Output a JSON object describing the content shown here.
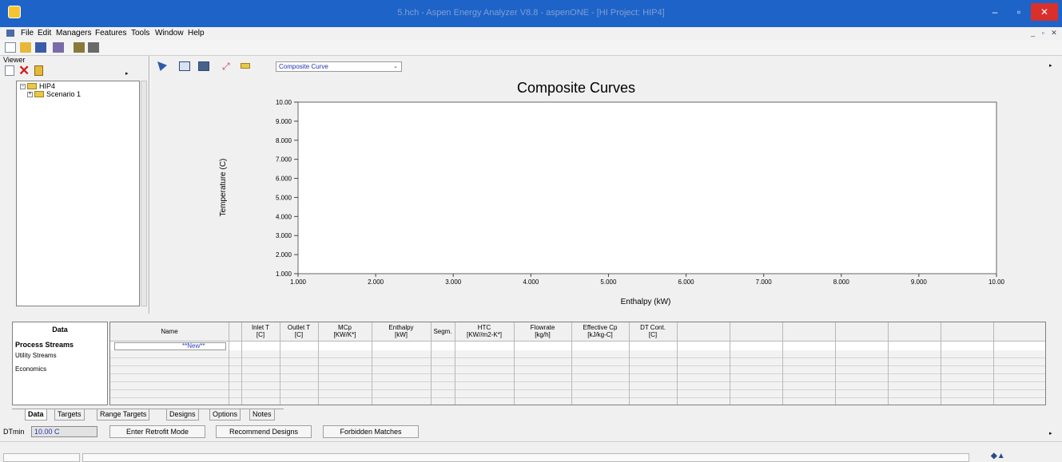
{
  "window": {
    "title": "5.hch - Aspen Energy Analyzer V8.8 - aspenONE - [HI Project: HIP4]",
    "controls": {
      "minimize": "–",
      "maximize": "▫",
      "close": "✕"
    }
  },
  "menu": [
    "File",
    "Edit",
    "Managers",
    "Features",
    "Tools",
    "Window",
    "Help"
  ],
  "viewer": {
    "label": "Viewer",
    "tree": {
      "root": "HIP4",
      "child": "Scenario 1"
    }
  },
  "chart_toolbar": {
    "selected_view": "Composite Curve"
  },
  "chart_data": {
    "type": "line",
    "title": "Composite Curves",
    "xlabel": "Enthalpy (kW)",
    "ylabel": "Temperature (C)",
    "xlim": [
      1.0,
      10.0
    ],
    "ylim": [
      1.0,
      10.0
    ],
    "x_ticks": [
      "1.000",
      "2.000",
      "3.000",
      "4.000",
      "5.000",
      "6.000",
      "7.000",
      "8.000",
      "9.000",
      "10.00"
    ],
    "y_ticks": [
      "1.000",
      "2.000",
      "3.000",
      "4.000",
      "5.000",
      "6.000",
      "7.000",
      "8.000",
      "9.000",
      "10.00"
    ],
    "series": []
  },
  "data_panel": {
    "header": "Data",
    "items": [
      "Process Streams",
      "Utility Streams",
      "Economics"
    ]
  },
  "grid": {
    "columns": [
      {
        "l1": "Name",
        "l2": ""
      },
      {
        "l1": "",
        "l2": ""
      },
      {
        "l1": "Inlet T",
        "l2": "[C]"
      },
      {
        "l1": "Outlet T",
        "l2": "[C]"
      },
      {
        "l1": "MCp",
        "l2": "[KW/K*]"
      },
      {
        "l1": "Enthalpy",
        "l2": "[kW]"
      },
      {
        "l1": "Segm.",
        "l2": ""
      },
      {
        "l1": "HTC",
        "l2": "[KW//m2-K*]"
      },
      {
        "l1": "Flowrate",
        "l2": "[kg/h]"
      },
      {
        "l1": "Effective Cp",
        "l2": "[kJ/kg-C]"
      },
      {
        "l1": "DT Cont.",
        "l2": "[C]"
      }
    ],
    "new_row": "**New**"
  },
  "tabs": [
    "Data",
    "Targets",
    "Range Targets",
    "Designs",
    "Options",
    "Notes"
  ],
  "dtmin": {
    "label": "DTmin",
    "value": "10.00 C"
  },
  "buttons": [
    "Enter Retrofit Mode",
    "Recommend Designs",
    "Forbidden Matches"
  ]
}
